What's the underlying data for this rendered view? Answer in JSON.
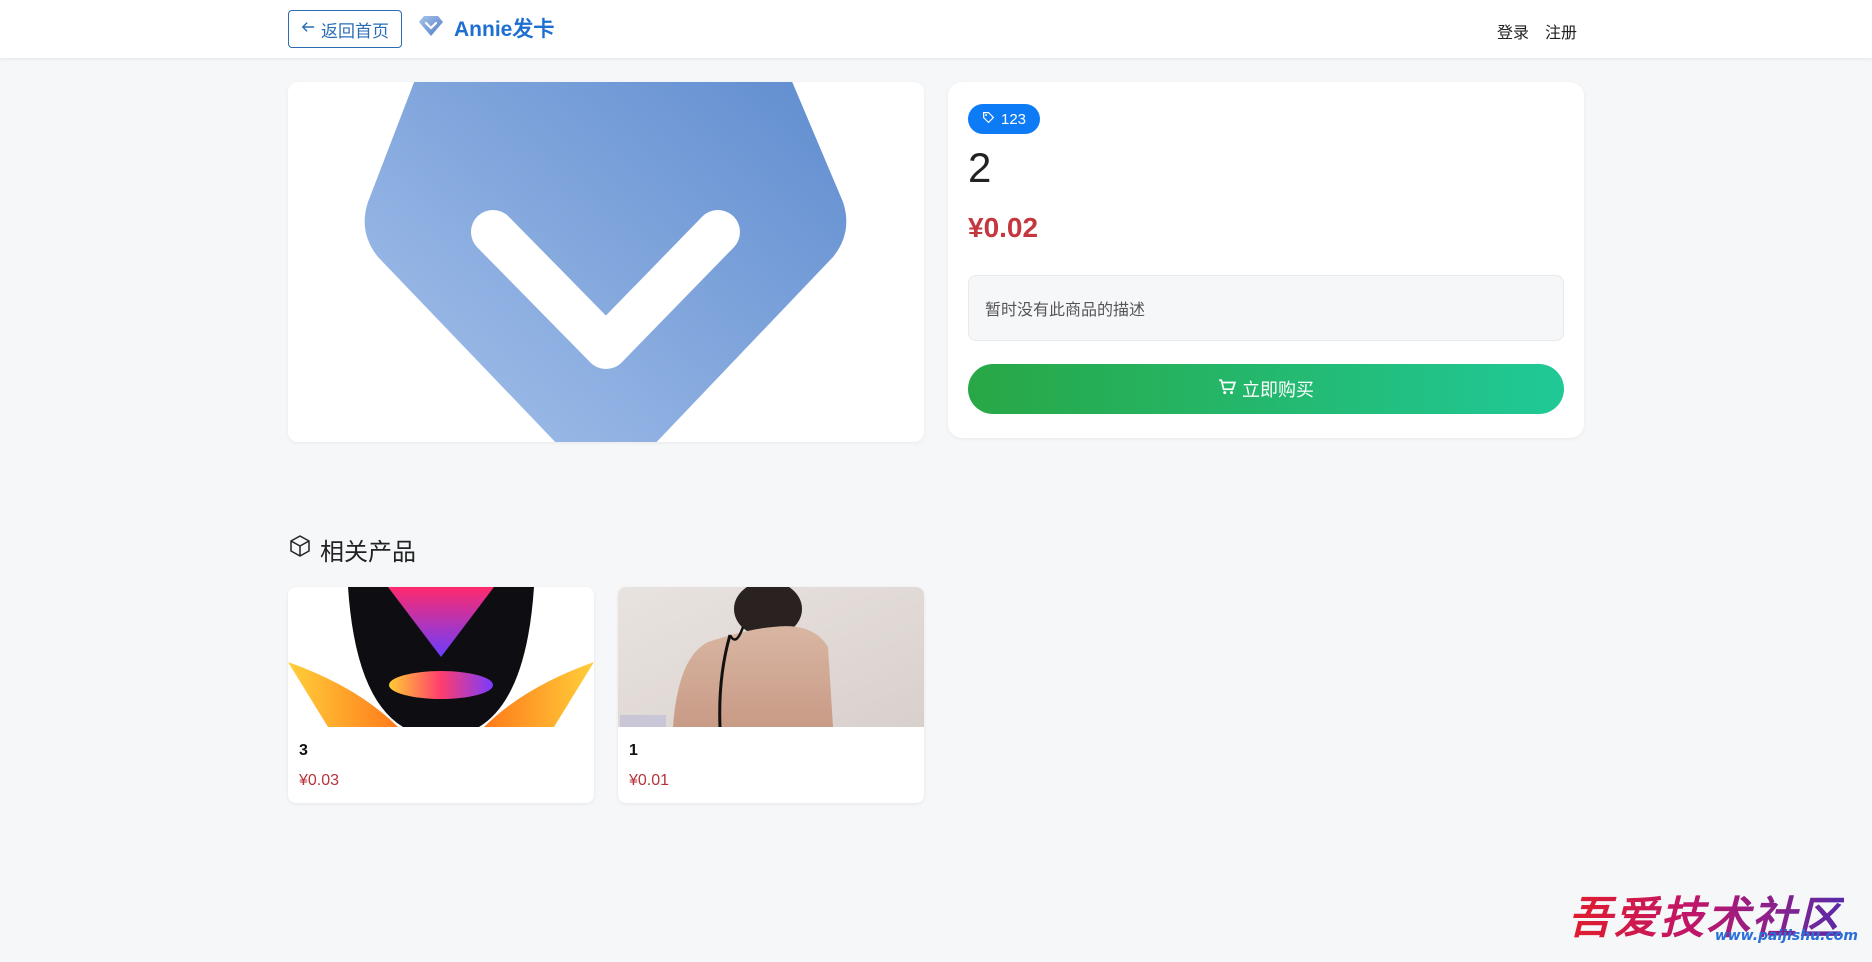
{
  "header": {
    "back_label": "返回首页",
    "brand_name": "Annie发卡",
    "login_label": "登录",
    "register_label": "注册"
  },
  "product": {
    "tag": "123",
    "name": "2",
    "price": "¥0.02",
    "description": "暂时没有此商品的描述",
    "buy_label": "立即购买"
  },
  "related": {
    "title": "相关产品",
    "items": [
      {
        "name": "3",
        "price": "¥0.03"
      },
      {
        "name": "1",
        "price": "¥0.01"
      }
    ]
  },
  "watermark": {
    "text": "吾爱技术社区",
    "url": "www.paijishu.com"
  },
  "colors": {
    "brand": "#1f6fd1",
    "price": "#c5373f",
    "tag_bg": "#0d7bf5",
    "buy_gradient_start": "#28a745",
    "buy_gradient_end": "#20c997"
  }
}
